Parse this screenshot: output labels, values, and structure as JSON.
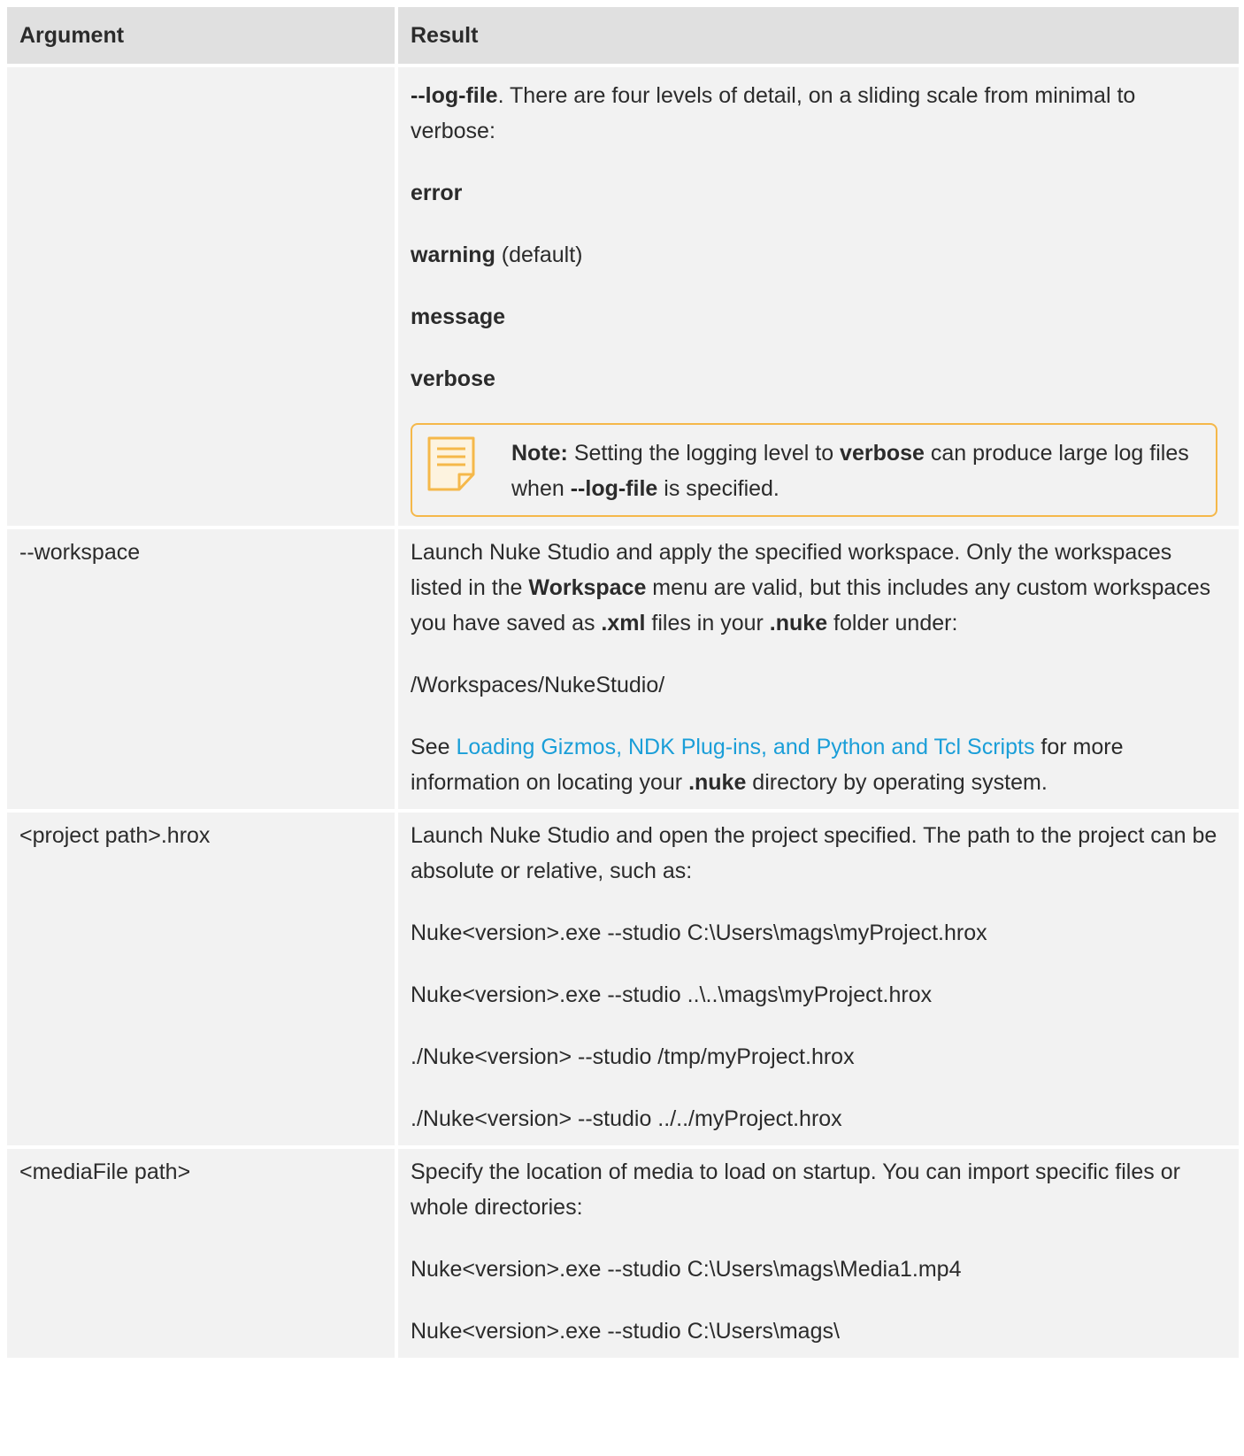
{
  "table": {
    "headers": {
      "argument": "Argument",
      "result": "Result"
    },
    "row_loglevel": {
      "p1_bold": "--log-file",
      "p1_rest": ". There are four levels of detail, on a sliding scale from minimal to verbose:",
      "levels": [
        {
          "bold": "error",
          "rest": ""
        },
        {
          "bold": "warning",
          "rest": " (default)"
        },
        {
          "bold": "message",
          "rest": ""
        },
        {
          "bold": "verbose",
          "rest": ""
        }
      ],
      "note": {
        "icon": "note-icon",
        "label": "Note:",
        "t1": "  Setting the logging level to ",
        "b1": "verbose",
        "t2": " can produce large log files when ",
        "b2": "--log-file",
        "t3": " is specified."
      }
    },
    "row_workspace": {
      "argument": "--workspace",
      "p1": {
        "t1": "Launch Nuke Studio and apply the specified workspace. Only the workspaces listed in the ",
        "b1": "Workspace",
        "t2": " menu are valid, but this includes any custom workspaces you have saved as ",
        "b2": ".xml",
        "t3": " files in your ",
        "b3": ".nuke",
        "t4": " folder under:"
      },
      "p2": "/Workspaces/NukeStudio/",
      "p3": {
        "t1": "See ",
        "link": "Loading Gizmos, NDK Plug-ins, and Python and Tcl Scripts",
        "t2": " for more information on locating your ",
        "b1": ".nuke",
        "t3": " directory by operating system."
      }
    },
    "row_project": {
      "argument": "<project path>.hrox",
      "p1": "Launch Nuke Studio and open the project specified. The path to the project can be absolute or relative, such as:",
      "examples": [
        "Nuke<version>.exe --studio C:\\Users\\mags\\myProject.hrox",
        "Nuke<version>.exe --studio ..\\..\\mags\\myProject.hrox",
        "./Nuke<version> --studio /tmp/myProject.hrox",
        "./Nuke<version> --studio ../../myProject.hrox"
      ]
    },
    "row_media": {
      "argument": "<mediaFile path>",
      "p1": "Specify the location of media to load on startup. You can import specific files or whole directories:",
      "examples": [
        "Nuke<version>.exe --studio C:\\Users\\mags\\Media1.mp4",
        "Nuke<version>.exe --studio C:\\Users\\mags\\"
      ]
    }
  },
  "colors": {
    "header_bg": "#e0e0e0",
    "cell_bg": "#f2f2f2",
    "note_border": "#f5b84a",
    "link": "#1a9ed8"
  }
}
